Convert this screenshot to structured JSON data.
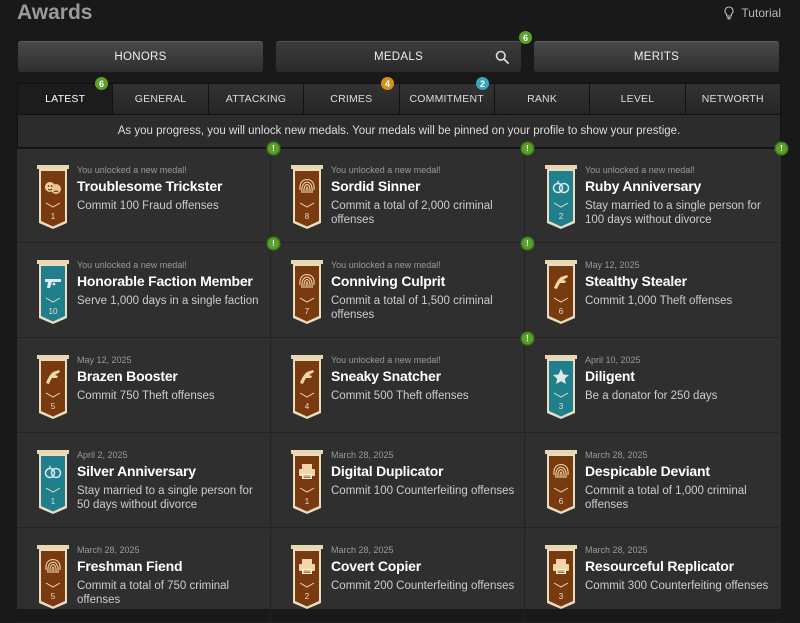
{
  "header": {
    "title": "Awards",
    "tutorial_label": "Tutorial"
  },
  "main_tabs": [
    {
      "label": "HONORS"
    },
    {
      "label": "MEDALS",
      "badge": "6"
    },
    {
      "label": "MERITS"
    }
  ],
  "sub_tabs": [
    {
      "label": "LATEST",
      "badge": "6",
      "badge_color": "#5aa12c"
    },
    {
      "label": "GENERAL"
    },
    {
      "label": "ATTACKING"
    },
    {
      "label": "CRIMES",
      "badge": "4",
      "badge_color": "#d88f1c"
    },
    {
      "label": "COMMITMENT",
      "badge": "2",
      "badge_color": "#3ba3bb"
    },
    {
      "label": "RANK"
    },
    {
      "label": "LEVEL"
    },
    {
      "label": "NETWORTH"
    }
  ],
  "info_text": "As you progress, you will unlock new medals. Your medals will be pinned on your profile to show your prestige.",
  "medals": [
    {
      "date": "You unlocked a new medal!",
      "name": "Troublesome Trickster",
      "desc": "Commit 100 Fraud offenses",
      "icon": "masks-icon",
      "number": "1",
      "color": "#7a3a10",
      "new": true
    },
    {
      "date": "You unlocked a new medal!",
      "name": "Sordid Sinner",
      "desc": "Commit a total of 2,000 criminal offenses",
      "icon": "fingerprint-icon",
      "number": "8",
      "color": "#7a3a10",
      "new": true
    },
    {
      "date": "You unlocked a new medal!",
      "name": "Ruby Anniversary",
      "desc": "Stay married to a single person for 100 days without divorce",
      "icon": "rings-icon",
      "number": "2",
      "color": "#1f7f8c",
      "new": true
    },
    {
      "date": "You unlocked a new medal!",
      "name": "Honorable Faction Member",
      "desc": "Serve 1,000 days in a single faction",
      "icon": "revolver-icon",
      "number": "10",
      "color": "#1f7f8c",
      "new": true
    },
    {
      "date": "You unlocked a new medal!",
      "name": "Conniving Culprit",
      "desc": "Commit a total of 1,500 criminal offenses",
      "icon": "fingerprint-icon",
      "number": "7",
      "color": "#7a3a10",
      "new": true
    },
    {
      "date": "May 12, 2025",
      "name": "Stealthy Stealer",
      "desc": "Commit 1,000 Theft offenses",
      "icon": "hand-icon",
      "number": "6",
      "color": "#7a3a10",
      "new": false
    },
    {
      "date": "May 12, 2025",
      "name": "Brazen Booster",
      "desc": "Commit 750 Theft offenses",
      "icon": "hand-icon",
      "number": "5",
      "color": "#7a3a10",
      "new": false
    },
    {
      "date": "You unlocked a new medal!",
      "name": "Sneaky Snatcher",
      "desc": "Commit 500 Theft offenses",
      "icon": "hand-icon",
      "number": "4",
      "color": "#7a3a10",
      "new": true
    },
    {
      "date": "April 10, 2025",
      "name": "Diligent",
      "desc": "Be a donator for 250 days",
      "icon": "star-icon",
      "number": "3",
      "color": "#1f7f8c",
      "new": false
    },
    {
      "date": "April 2, 2025",
      "name": "Silver Anniversary",
      "desc": "Stay married to a single person for 50 days without divorce",
      "icon": "rings-icon",
      "number": "1",
      "color": "#1f7f8c",
      "new": false
    },
    {
      "date": "March 28, 2025",
      "name": "Digital Duplicator",
      "desc": "Commit 100 Counterfeiting offenses",
      "icon": "printer-icon",
      "number": "1",
      "color": "#7a3a10",
      "new": false
    },
    {
      "date": "March 28, 2025",
      "name": "Despicable Deviant",
      "desc": "Commit a total of 1,000 criminal offenses",
      "icon": "fingerprint-icon",
      "number": "6",
      "color": "#7a3a10",
      "new": false
    },
    {
      "date": "March 28, 2025",
      "name": "Freshman Fiend",
      "desc": "Commit a total of 750 criminal offenses",
      "icon": "fingerprint-icon",
      "number": "5",
      "color": "#7a3a10",
      "new": false
    },
    {
      "date": "March 28, 2025",
      "name": "Covert Copier",
      "desc": "Commit 200 Counterfeiting offenses",
      "icon": "printer-icon",
      "number": "2",
      "color": "#7a3a10",
      "new": false
    },
    {
      "date": "March 28, 2025",
      "name": "Resourceful Replicator",
      "desc": "Commit 300 Counterfeiting offenses",
      "icon": "printer-icon",
      "number": "3",
      "color": "#7a3a10",
      "new": false
    }
  ]
}
